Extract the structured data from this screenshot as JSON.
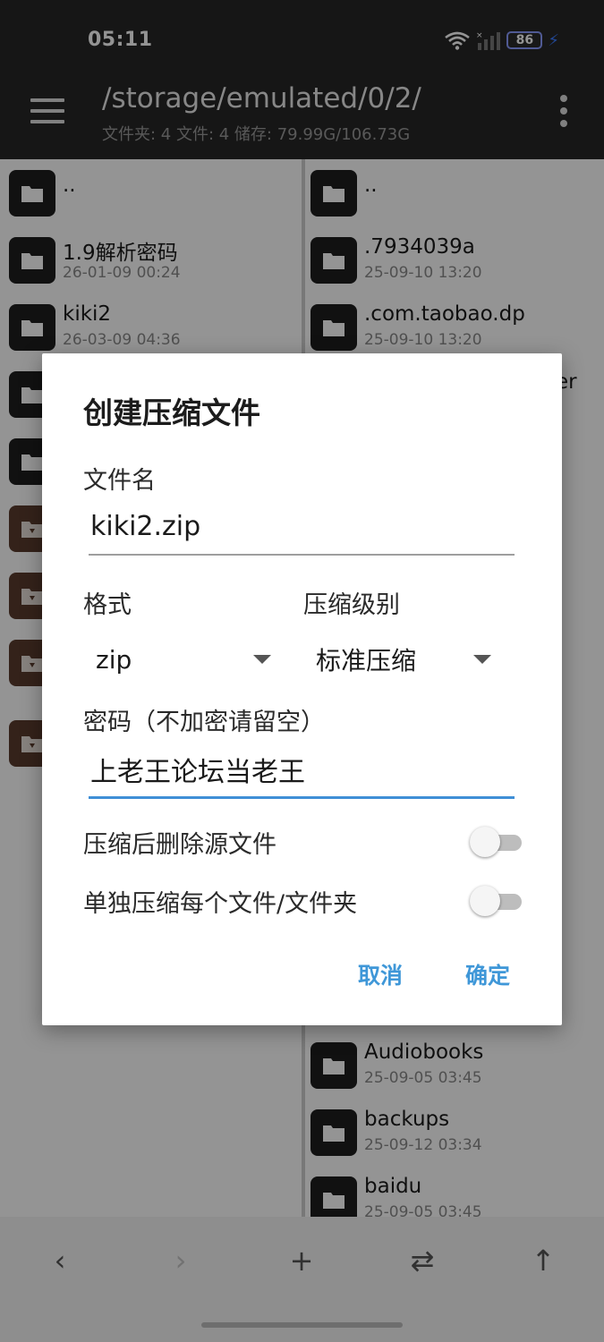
{
  "status": {
    "time": "05:11",
    "battery": "86"
  },
  "appbar": {
    "path": "/storage/emulated/0/2/",
    "info": "文件夹: 4  文件: 4  储存: 79.99G/106.73G"
  },
  "left_pane": {
    "items": [
      {
        "name": "..",
        "date": "",
        "type": "folder"
      },
      {
        "name": "1.9解析密码",
        "date": "26-01-09 00:24",
        "type": "folder"
      },
      {
        "name": "kiki2",
        "date": "26-03-09 04:36",
        "type": "folder"
      },
      {
        "name": "",
        "date": "",
        "type": "folder"
      },
      {
        "name": "",
        "date": "",
        "type": "folder"
      },
      {
        "name": "",
        "date": "",
        "type": "archive"
      },
      {
        "name": "",
        "date": "",
        "type": "archive"
      },
      {
        "name": "",
        "date": "",
        "type": "archive"
      },
      {
        "name": "",
        "date": "",
        "type": "archive"
      }
    ]
  },
  "right_pane": {
    "items": [
      {
        "name": "..",
        "date": "",
        "type": "folder"
      },
      {
        "name": ".7934039a",
        "date": "25-09-10 13:20",
        "type": "folder"
      },
      {
        "name": ".com.taobao.dp",
        "date": "25-09-10 13:20",
        "type": "folder"
      },
      {
        "name": "Audiobooks",
        "date": "25-09-05 03:45",
        "type": "folder"
      },
      {
        "name": "backups",
        "date": "25-09-12 03:34",
        "type": "folder"
      },
      {
        "name": "baidu",
        "date": "25-09-05 03:45",
        "type": "folder"
      }
    ],
    "partial_text": "er"
  },
  "dialog": {
    "title": "创建压缩文件",
    "filename_label": "文件名",
    "filename_value": "kiki2.zip",
    "format_label": "格式",
    "format_value": "zip",
    "level_label": "压缩级别",
    "level_value": "标准压缩",
    "password_label": "密码（不加密请留空）",
    "password_value": "上老王论坛当老王",
    "delete_source_label": "压缩后删除源文件",
    "delete_source_on": false,
    "separate_label": "单独压缩每个文件/文件夹",
    "separate_on": false,
    "cancel_label": "取消",
    "ok_label": "确定"
  },
  "toolbar": {
    "back": "‹",
    "forward": "›",
    "add": "+",
    "swap": "⇄",
    "up": "↑"
  },
  "colors": {
    "accent": "#3f97d8",
    "topbar": "#262626",
    "folder_icon": "#1e1e1e",
    "archive_icon": "#5a3b2d"
  }
}
